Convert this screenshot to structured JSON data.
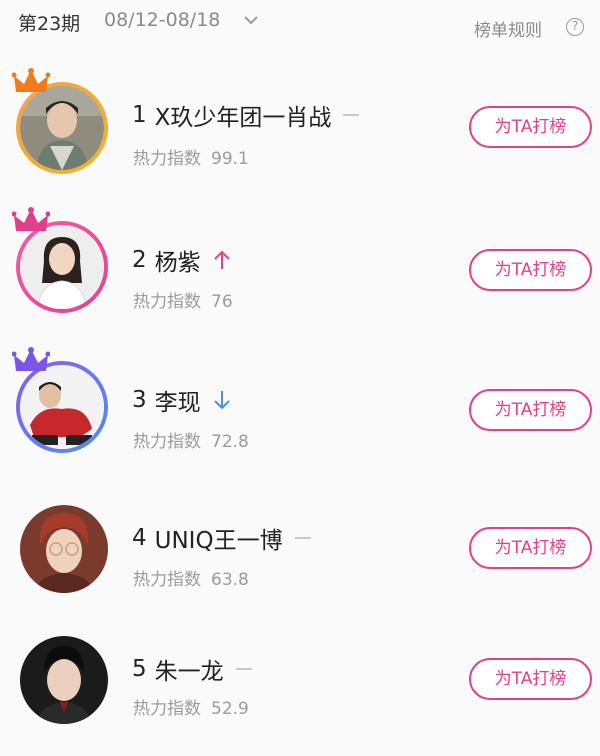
{
  "header": {
    "issue": "第23期",
    "date_range": "08/12-08/18",
    "rules_label": "榜单规则",
    "help_glyph": "?"
  },
  "colors": {
    "accent": "#e1408a",
    "up_arrow": "#e1408a",
    "down_arrow": "#4a90e2",
    "crown_1": "#f27a1a",
    "crown_2": "#e13f8c",
    "crown_3": "#7a55e8"
  },
  "ranking": [
    {
      "rank": "1",
      "name": "X玖少年团一肖战",
      "trend": "same",
      "heat_label": "热力指数",
      "heat": "99.1",
      "button": "为TA打榜"
    },
    {
      "rank": "2",
      "name": "杨紫",
      "trend": "up",
      "heat_label": "热力指数",
      "heat": "76",
      "button": "为TA打榜"
    },
    {
      "rank": "3",
      "name": "李现",
      "trend": "down",
      "heat_label": "热力指数",
      "heat": "72.8",
      "button": "为TA打榜"
    },
    {
      "rank": "4",
      "name": "UNIQ王一博",
      "trend": "same",
      "heat_label": "热力指数",
      "heat": "63.8",
      "button": "为TA打榜"
    },
    {
      "rank": "5",
      "name": "朱一龙",
      "trend": "same",
      "heat_label": "热力指数",
      "heat": "52.9",
      "button": "为TA打榜"
    }
  ]
}
